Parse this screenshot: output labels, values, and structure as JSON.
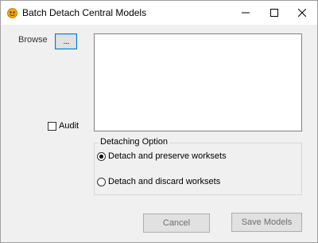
{
  "window": {
    "title": "Batch Detach Central Models",
    "icon": "revit-app-icon"
  },
  "titlebar_buttons": {
    "minimize": "minimize-icon",
    "maximize": "maximize-icon",
    "close": "close-icon"
  },
  "browse": {
    "label": "Browse",
    "button_label": "....."
  },
  "audit": {
    "label": "Audit",
    "checked": false
  },
  "detaching": {
    "legend": "Detaching Option",
    "options": [
      {
        "label": "Detach and preserve worksets",
        "checked": true
      },
      {
        "label": "Detach and discard worksets",
        "checked": false
      }
    ]
  },
  "buttons": {
    "cancel": "Cancel",
    "save": "Save Models"
  }
}
